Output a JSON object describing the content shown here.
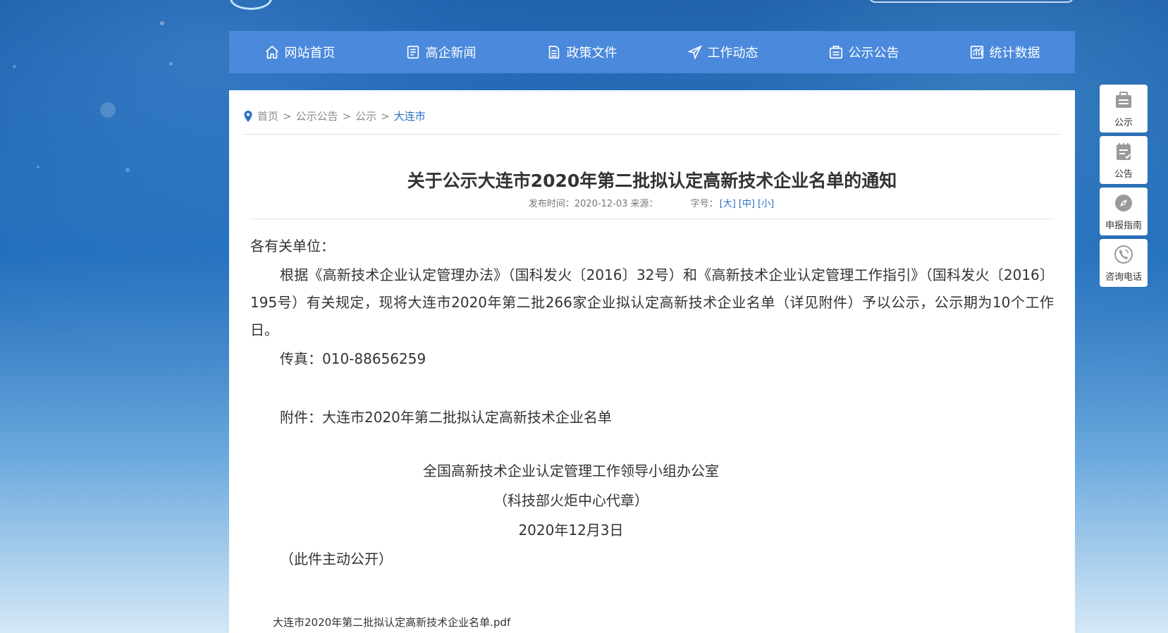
{
  "nav": {
    "items": [
      {
        "label": "网站首页",
        "icon": "home-icon"
      },
      {
        "label": "高企新闻",
        "icon": "news-icon"
      },
      {
        "label": "政策文件",
        "icon": "document-icon"
      },
      {
        "label": "工作动态",
        "icon": "send-icon"
      },
      {
        "label": "公示公告",
        "icon": "announcement-icon"
      },
      {
        "label": "统计数据",
        "icon": "chart-icon"
      }
    ]
  },
  "breadcrumb": {
    "items": [
      "首页",
      "公示公告",
      "公示"
    ],
    "current": "大连市",
    "separator": ">"
  },
  "article": {
    "title": "关于公示大连市2020年第二批拟认定高新技术企业名单的通知",
    "meta_date": "发布时间：2020-12-03 来源：",
    "font_size_label": "字号：",
    "font_sizes": [
      "[大]",
      "[中]",
      "[小]"
    ],
    "salutation": "各有关单位：",
    "paragraph": "根据《高新技术企业认定管理办法》（国科发火〔2016〕32号）和《高新技术企业认定管理工作指引》（国科发火〔2016〕195号）有关规定，现将大连市2020年第二批266家企业拟认定高新技术企业名单（详见附件）予以公示，公示期为10个工作日。",
    "fax": "传真：010-88656259",
    "attachment_line": "附件：大连市2020年第二批拟认定高新技术企业名单",
    "signature_org": "全国高新技术企业认定管理工作领导小组办公室",
    "signature_seal": "（科技部火炬中心代章）",
    "signature_date": "2020年12月3日",
    "publicity": "（此件主动公开）",
    "attachment_file": "大连市2020年第二批拟认定高新技术企业名单.pdf"
  },
  "float_menu": [
    {
      "label": "公示",
      "icon": "briefcase-icon"
    },
    {
      "label": "公告",
      "icon": "notepad-icon"
    },
    {
      "label": "申报指南",
      "icon": "compass-icon"
    },
    {
      "label": "咨询电话",
      "icon": "phone-icon"
    }
  ],
  "colors": {
    "nav_bg": "#4a89dc",
    "link_blue": "#2a6fc4",
    "icon_gray": "#9a9a9a"
  }
}
